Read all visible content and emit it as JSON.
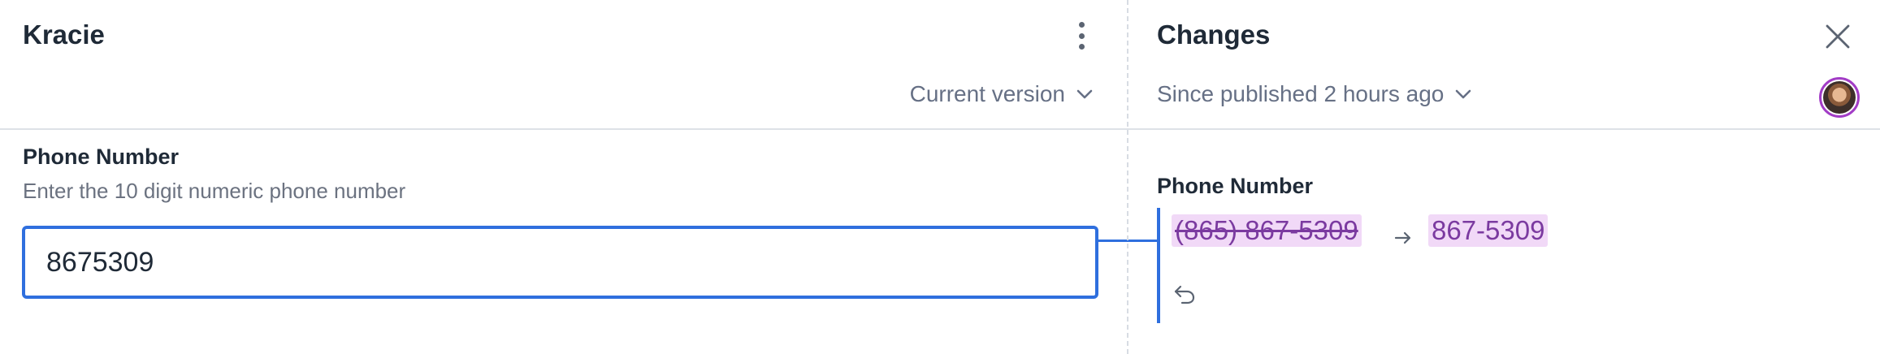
{
  "editor": {
    "title": "Kracie",
    "version_label": "Current version",
    "field": {
      "label": "Phone Number",
      "help": "Enter the 10 digit numeric phone number",
      "value": "8675309"
    }
  },
  "changes": {
    "title": "Changes",
    "since_label": "Since published 2 hours ago",
    "field_label": "Phone Number",
    "old_value": "(865) 867-5309",
    "new_value": "867-5309"
  },
  "colors": {
    "accent": "#2f6fde",
    "diff_text": "#7b3aa0",
    "diff_bg": "#f1d9f7",
    "avatar_ring": "#a23cc6"
  },
  "icons": {
    "more": "vertical-dots",
    "close": "x",
    "chevron": "chevron-down",
    "arrow": "arrow-right",
    "undo": "undo"
  }
}
